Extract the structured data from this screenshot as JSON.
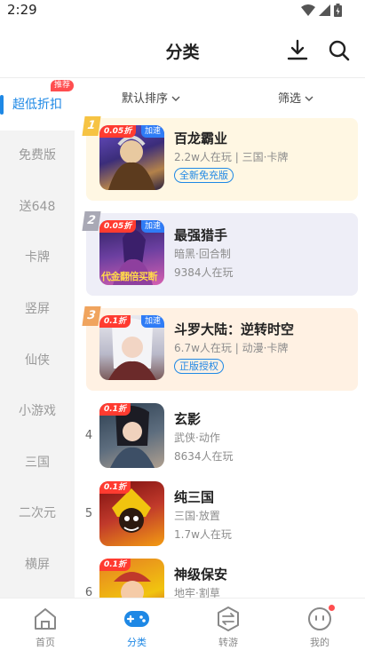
{
  "status": {
    "time": "2:29"
  },
  "header": {
    "title": "分类"
  },
  "sidebar": {
    "badge": "推荐",
    "items": [
      {
        "label": "超低折扣"
      },
      {
        "label": "免费版"
      },
      {
        "label": "送648"
      },
      {
        "label": "卡牌"
      },
      {
        "label": "竖屏"
      },
      {
        "label": "仙侠"
      },
      {
        "label": "小游戏"
      },
      {
        "label": "三国"
      },
      {
        "label": "二次元"
      },
      {
        "label": "横屏"
      }
    ]
  },
  "sort": {
    "order": "默认排序",
    "filter": "筛选"
  },
  "games": [
    {
      "rank": "1",
      "name": "百龙霸业",
      "line1": "2.2w人在玩 | 三国·卡牌",
      "tag": "全新免充版",
      "discount": "0.05折",
      "boost": "加速"
    },
    {
      "rank": "2",
      "name": "最强猎手",
      "line1": "暗黑·回合制",
      "line2": "9384人在玩",
      "discount": "0.05折",
      "boost": "加速",
      "banner": "代金翻倍买断"
    },
    {
      "rank": "3",
      "name": "斗罗大陆：逆转时空",
      "line1": "6.7w人在玩 | 动漫·卡牌",
      "tag": "正版授权",
      "discount": "0.1折",
      "boost": "加速"
    },
    {
      "rank": "4",
      "name": "玄影",
      "line1": "武侠·动作",
      "line2": "8634人在玩",
      "discount": "0.1折"
    },
    {
      "rank": "5",
      "name": "纯三国",
      "line1": "三国·放置",
      "line2": "1.7w人在玩",
      "discount": "0.1折"
    },
    {
      "rank": "6",
      "name": "神级保安",
      "line1": "地牢·割草",
      "discount": "0.1折"
    }
  ],
  "nav": [
    {
      "label": "首页"
    },
    {
      "label": "分类"
    },
    {
      "label": "转游"
    },
    {
      "label": "我的"
    }
  ],
  "colors": {
    "accent": "#1e88e5",
    "badge": "#ff4d4f",
    "rank1": "#f6c343",
    "rank2": "#a9a9b5",
    "rank3": "#f0a45e"
  }
}
